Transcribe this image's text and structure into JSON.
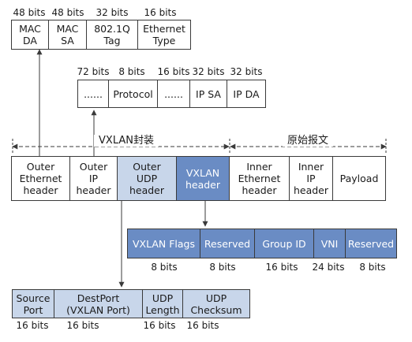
{
  "eth_header": {
    "bits": [
      "48 bits",
      "48 bits",
      "32 bits",
      "16 bits"
    ],
    "fields": [
      [
        "MAC",
        "DA"
      ],
      [
        "MAC",
        "SA"
      ],
      [
        "802.1Q",
        "Tag"
      ],
      [
        "Ethernet",
        "Type"
      ]
    ]
  },
  "ip_header": {
    "bits": [
      "72 bits",
      "8 bits",
      "16 bits",
      "32 bits",
      "32 bits"
    ],
    "fields": [
      "......",
      "Protocol",
      "......",
      "IP SA",
      "IP DA"
    ]
  },
  "sections": {
    "vxlan_encap": "VXLAN封装",
    "original": "原始报文"
  },
  "packet": {
    "fields": [
      [
        "Outer",
        "Ethernet",
        "header"
      ],
      [
        "Outer",
        "IP",
        "header"
      ],
      [
        "Outer",
        "UDP",
        "header"
      ],
      [
        "VXLAN",
        "header"
      ],
      [
        "Inner",
        "Ethernet",
        "header"
      ],
      [
        "Inner",
        "IP",
        "header"
      ],
      [
        "Payload"
      ]
    ]
  },
  "vxlan_header": {
    "fields": [
      "VXLAN Flags",
      "Reserved",
      "Group ID",
      "VNI",
      "Reserved"
    ],
    "bits": [
      "8 bits",
      "8 bits",
      "16 bits",
      "24 bits",
      "8 bits"
    ]
  },
  "udp_header": {
    "fields": [
      [
        "Source",
        "Port"
      ],
      [
        "DestPort",
        "(VXLAN Port)"
      ],
      [
        "UDP",
        "Length"
      ],
      [
        "UDP",
        "Checksum"
      ]
    ],
    "bits": [
      "16 bits",
      "16 bits",
      "16 bits",
      "16 bits"
    ]
  },
  "colors": {
    "light": "#c8d6ea",
    "dark": "#6a8cc4",
    "line": "#3a3a3a"
  }
}
